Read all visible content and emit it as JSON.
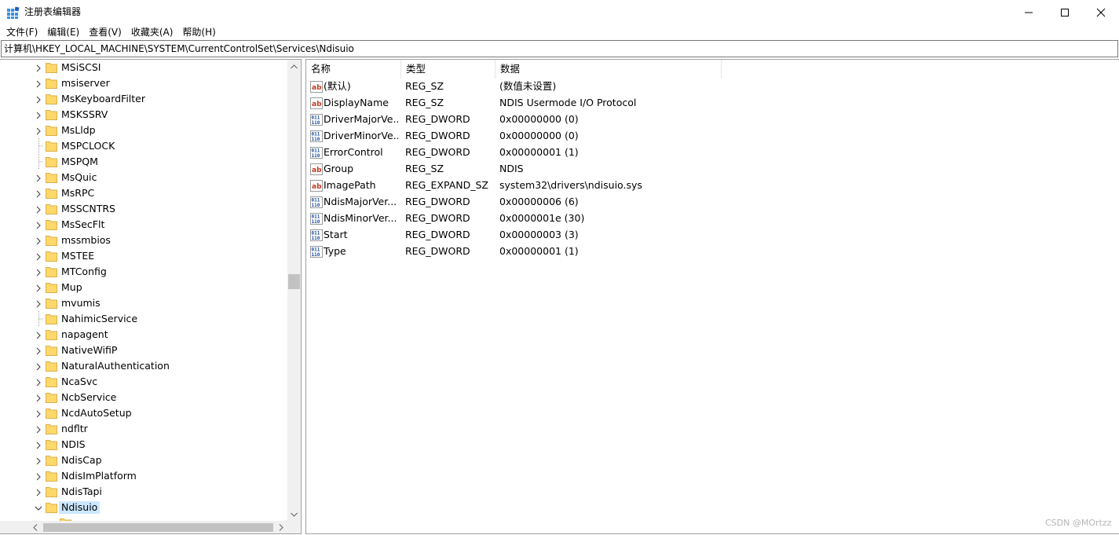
{
  "window": {
    "title": "注册表编辑器",
    "minimize_icon": "minimize-icon",
    "maximize_icon": "maximize-icon",
    "close_icon": "close-icon"
  },
  "menu": [
    "文件(F)",
    "编辑(E)",
    "查看(V)",
    "收藏夹(A)",
    "帮助(H)"
  ],
  "address": "计算机\\HKEY_LOCAL_MACHINE\\SYSTEM\\CurrentControlSet\\Services\\Ndisuio",
  "tree": {
    "items": [
      {
        "label": "MSiSCSI",
        "expandable": true
      },
      {
        "label": "msiserver",
        "expandable": true
      },
      {
        "label": "MsKeyboardFilter",
        "expandable": true
      },
      {
        "label": "MSKSSRV",
        "expandable": true
      },
      {
        "label": "MsLldp",
        "expandable": true
      },
      {
        "label": "MSPCLOCK",
        "expandable": false
      },
      {
        "label": "MSPQM",
        "expandable": false
      },
      {
        "label": "MsQuic",
        "expandable": true
      },
      {
        "label": "MsRPC",
        "expandable": true
      },
      {
        "label": "MSSCNTRS",
        "expandable": true
      },
      {
        "label": "MsSecFlt",
        "expandable": true
      },
      {
        "label": "mssmbios",
        "expandable": true
      },
      {
        "label": "MSTEE",
        "expandable": true
      },
      {
        "label": "MTConfig",
        "expandable": true
      },
      {
        "label": "Mup",
        "expandable": true
      },
      {
        "label": "mvumis",
        "expandable": true
      },
      {
        "label": "NahimicService",
        "expandable": false
      },
      {
        "label": "napagent",
        "expandable": true
      },
      {
        "label": "NativeWifiP",
        "expandable": true
      },
      {
        "label": "NaturalAuthentication",
        "expandable": true
      },
      {
        "label": "NcaSvc",
        "expandable": true
      },
      {
        "label": "NcbService",
        "expandable": true
      },
      {
        "label": "NcdAutoSetup",
        "expandable": true
      },
      {
        "label": "ndfltr",
        "expandable": true
      },
      {
        "label": "NDIS",
        "expandable": true
      },
      {
        "label": "NdisCap",
        "expandable": true
      },
      {
        "label": "NdisImPlatform",
        "expandable": true
      },
      {
        "label": "NdisTapi",
        "expandable": true
      },
      {
        "label": "Ndisuio",
        "expandable": true,
        "expanded": true,
        "selected": true
      }
    ],
    "partial_child": true
  },
  "columns": {
    "name": "名称",
    "type": "类型",
    "data": "数据"
  },
  "values": [
    {
      "name": "(默认)",
      "type": "REG_SZ",
      "data": "(数值未设置)",
      "icon": "string-value-icon"
    },
    {
      "name": "DisplayName",
      "type": "REG_SZ",
      "data": "NDIS Usermode I/O Protocol",
      "icon": "string-value-icon"
    },
    {
      "name": "DriverMajorVe...",
      "type": "REG_DWORD",
      "data": "0x00000000 (0)",
      "icon": "binary-value-icon"
    },
    {
      "name": "DriverMinorVe...",
      "type": "REG_DWORD",
      "data": "0x00000000 (0)",
      "icon": "binary-value-icon"
    },
    {
      "name": "ErrorControl",
      "type": "REG_DWORD",
      "data": "0x00000001 (1)",
      "icon": "binary-value-icon"
    },
    {
      "name": "Group",
      "type": "REG_SZ",
      "data": "NDIS",
      "icon": "string-value-icon"
    },
    {
      "name": "ImagePath",
      "type": "REG_EXPAND_SZ",
      "data": "system32\\drivers\\ndisuio.sys",
      "icon": "string-value-icon"
    },
    {
      "name": "NdisMajorVer...",
      "type": "REG_DWORD",
      "data": "0x00000006 (6)",
      "icon": "binary-value-icon"
    },
    {
      "name": "NdisMinorVer...",
      "type": "REG_DWORD",
      "data": "0x0000001e (30)",
      "icon": "binary-value-icon"
    },
    {
      "name": "Start",
      "type": "REG_DWORD",
      "data": "0x00000003 (3)",
      "icon": "binary-value-icon"
    },
    {
      "name": "Type",
      "type": "REG_DWORD",
      "data": "0x00000001 (1)",
      "icon": "binary-value-icon"
    }
  ],
  "watermark": "CSDN @MOrtzz",
  "colors": {
    "selection": "#cce8ff",
    "folder": "#ffd86b",
    "string_icon": "#c23b22",
    "binary_icon": "#1c4fa0"
  }
}
